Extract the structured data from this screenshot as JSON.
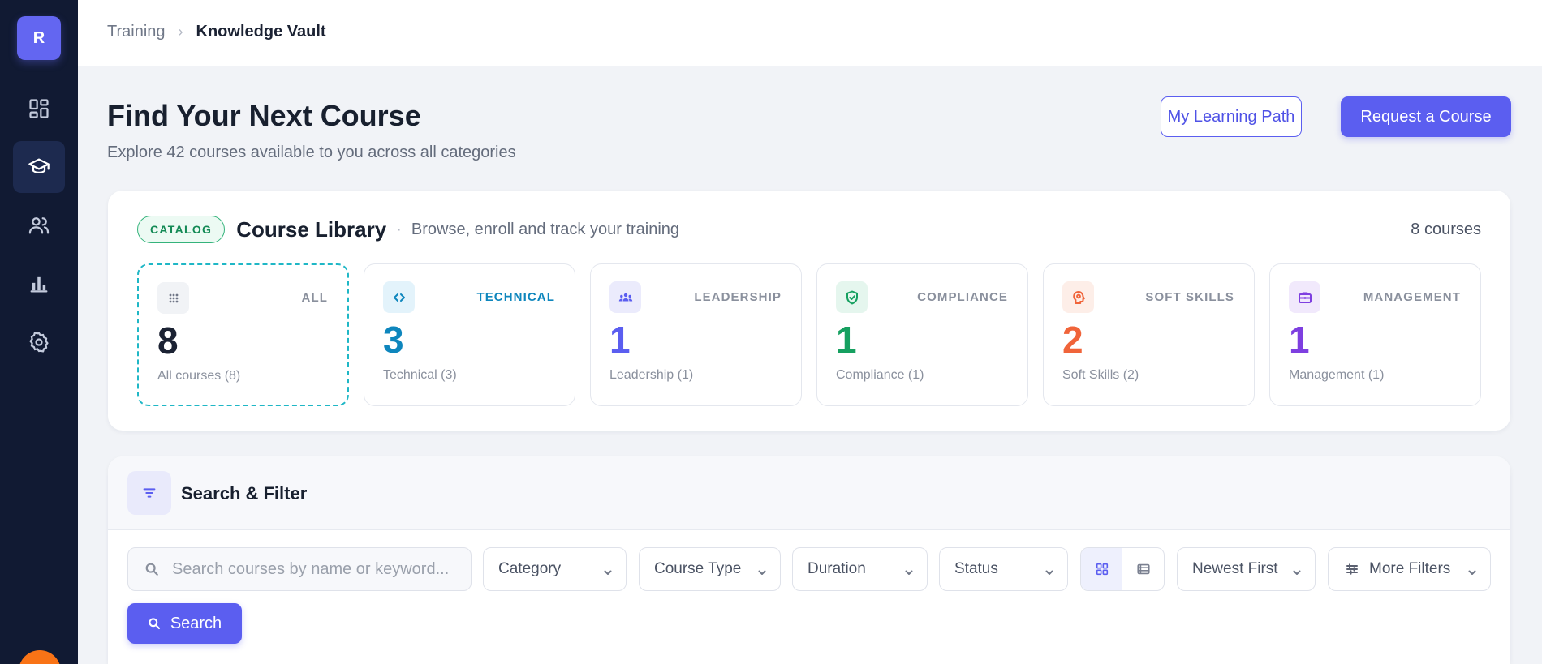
{
  "sidebar": {
    "logo_letter": "R",
    "items": [
      {
        "name": "dashboard",
        "icon": "dashboard-icon",
        "active": false
      },
      {
        "name": "training",
        "icon": "graduation-cap-icon",
        "active": true
      },
      {
        "name": "people",
        "icon": "users-icon",
        "active": false
      },
      {
        "name": "reports",
        "icon": "bar-chart-icon",
        "active": false
      },
      {
        "name": "settings",
        "icon": "gear-icon",
        "active": false
      }
    ]
  },
  "breadcrumb": {
    "parent": "Training",
    "separator": "›",
    "current": "Knowledge Vault"
  },
  "header": {
    "title": "Find Your Next Course",
    "subtitle": "Explore 42 courses available to you across all categories",
    "secondary_button": "My Learning Path",
    "primary_button": "Request a Course"
  },
  "library": {
    "badge": "CATALOG",
    "title": "Course Library",
    "separator": "·",
    "description": "Browse, enroll and track your training",
    "count_label": "8 courses",
    "categories": [
      {
        "label": "ALL",
        "count": "8",
        "sub": "All courses (8)",
        "icon": "grid-dots-icon",
        "color": "#1b2233",
        "label_color": "#8a909d",
        "icon_bg": "#f1f3f6",
        "icon_color": "#6f7686",
        "selected": true
      },
      {
        "label": "TECHNICAL",
        "count": "3",
        "sub": "Technical (3)",
        "icon": "code-icon",
        "color": "#0e86bd",
        "label_color": "#0e86bd",
        "icon_bg": "#e3f3fb",
        "icon_color": "#0e86bd",
        "selected": false
      },
      {
        "label": "LEADERSHIP",
        "count": "1",
        "sub": "Leadership (1)",
        "icon": "team-icon",
        "color": "#5b5ef0",
        "label_color": "#8a909d",
        "icon_bg": "#ebebfc",
        "icon_color": "#5b5ef0",
        "selected": false
      },
      {
        "label": "COMPLIANCE",
        "count": "1",
        "sub": "Compliance (1)",
        "icon": "shield-check-icon",
        "color": "#16a060",
        "label_color": "#8a909d",
        "icon_bg": "#e5f6ee",
        "icon_color": "#16a060",
        "selected": false
      },
      {
        "label": "SOFT SKILLS",
        "count": "2",
        "sub": "Soft Skills (2)",
        "icon": "brain-icon",
        "color": "#f0643a",
        "label_color": "#8a909d",
        "icon_bg": "#fdeee8",
        "icon_color": "#f0643a",
        "selected": false
      },
      {
        "label": "MANAGEMENT",
        "count": "1",
        "sub": "Management (1)",
        "icon": "briefcase-icon",
        "color": "#7e3fe0",
        "label_color": "#8a909d",
        "icon_bg": "#f1e9fc",
        "icon_color": "#7e3fe0",
        "selected": false
      }
    ]
  },
  "filters": {
    "title": "Search & Filter",
    "search_placeholder": "Search courses by name or keyword...",
    "category": "Category",
    "course_type": "Course Type",
    "duration": "Duration",
    "status": "Status",
    "sort": "Newest First",
    "more": "More Filters",
    "search_button": "Search",
    "view_mode": "grid"
  },
  "colors": {
    "accent": "#5b5ef0",
    "sidebar": "#111a33",
    "selected_border": "#1fb7c6"
  }
}
